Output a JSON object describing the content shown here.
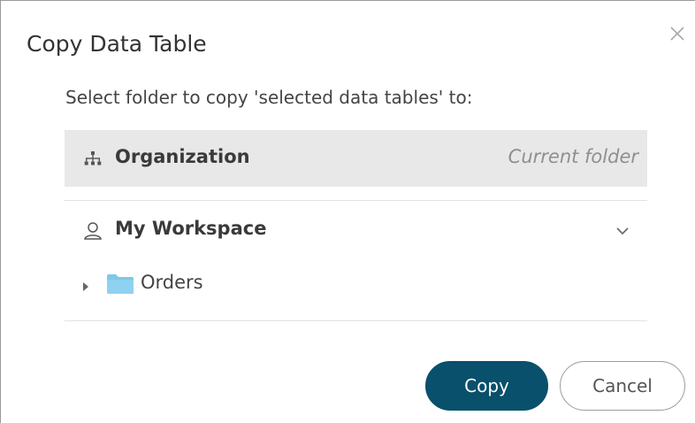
{
  "dialog": {
    "title": "Copy Data Table",
    "instruction": "Select folder to copy 'selected data tables' to:"
  },
  "organization": {
    "label": "Organization",
    "current_label": "Current folder",
    "icon": "hierarchy-icon"
  },
  "workspace": {
    "label": "My Workspace",
    "icon": "user-icon",
    "expanded": true,
    "folders": [
      {
        "label": "Orders",
        "icon": "folder-icon",
        "expanded": false
      }
    ]
  },
  "buttons": {
    "copy_label": "Copy",
    "cancel_label": "Cancel"
  },
  "colors": {
    "primary": "#08506c",
    "folder": "#7ec8e9",
    "selected_row": "#e8e8e8"
  }
}
